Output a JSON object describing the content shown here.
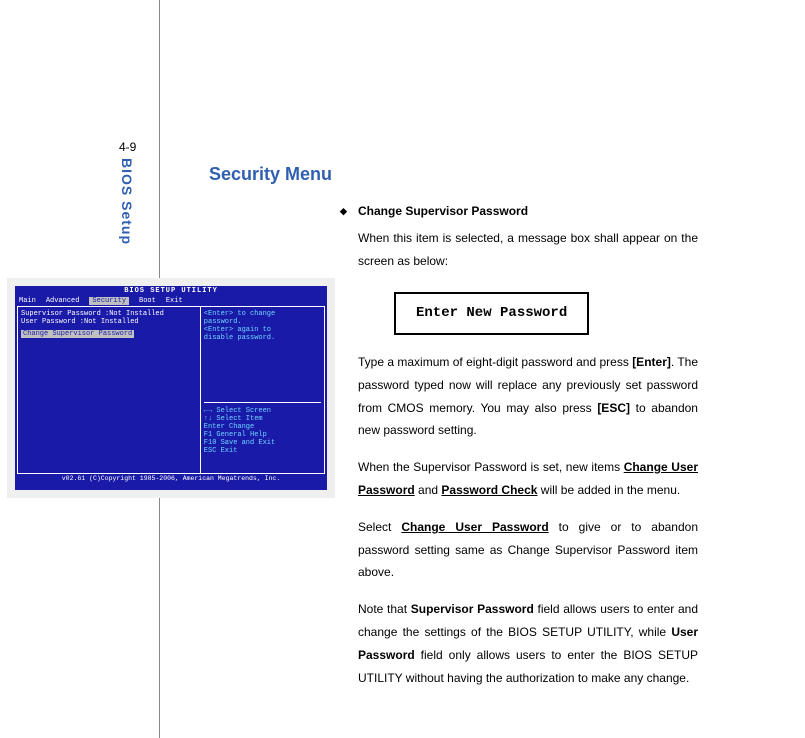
{
  "page_number": "4-9",
  "sidebar_label": "BIOS Setup",
  "heading": "Security Menu",
  "sub_heading": "Change Supervisor Password",
  "para1": "When this item is selected, a message box shall appear on the screen as below:",
  "password_box": "Enter New Password",
  "para2a": "Type a maximum of eight-digit password and press ",
  "para2_enter": "[Enter]",
  "para2b": ". The password typed now will replace any previously set password from CMOS memory. You may also press ",
  "para2_esc": "[ESC]",
  "para2c": " to abandon new password setting.",
  "para3a": "When the Supervisor Password is set, new items ",
  "para3_cup": "Change User Password",
  "para3b": " and ",
  "para3_pc": "Password Check",
  "para3c": " will be added in the menu.",
  "para4a": "Select ",
  "para4_cup": "Change User Password",
  "para4b": " to give or to abandon password setting same as Change Supervisor Password item above.",
  "para5a": "Note that ",
  "para5_sp": "Supervisor Password",
  "para5b": " field allows users to enter and change the settings of the BIOS SETUP UTILITY, while ",
  "para5_up": "User Password",
  "para5c": " field only allows users to enter the BIOS SETUP UTILITY without having the authorization to make any change.",
  "bios": {
    "title": "BIOS SETUP UTILITY",
    "menu": [
      "Main",
      "Advanced",
      "Security",
      "Boot",
      "Exit"
    ],
    "left_line1": "Supervisor Password :Not Installed",
    "left_line2": "User Password       :Not Installed",
    "left_selected": "Change Supervisor Password",
    "right_help1": "<Enter> to change",
    "right_help2": "password.",
    "right_help3": "<Enter> again to",
    "right_help4": "disable password.",
    "keys1": "←→   Select Screen",
    "keys2": "↑↓   Select Item",
    "keys3": "Enter Change",
    "keys4": "F1   General Help",
    "keys5": "F10  Save and Exit",
    "keys6": "ESC  Exit",
    "footer": "v02.61 (C)Copyright 1985-2006, American Megatrends, Inc."
  }
}
